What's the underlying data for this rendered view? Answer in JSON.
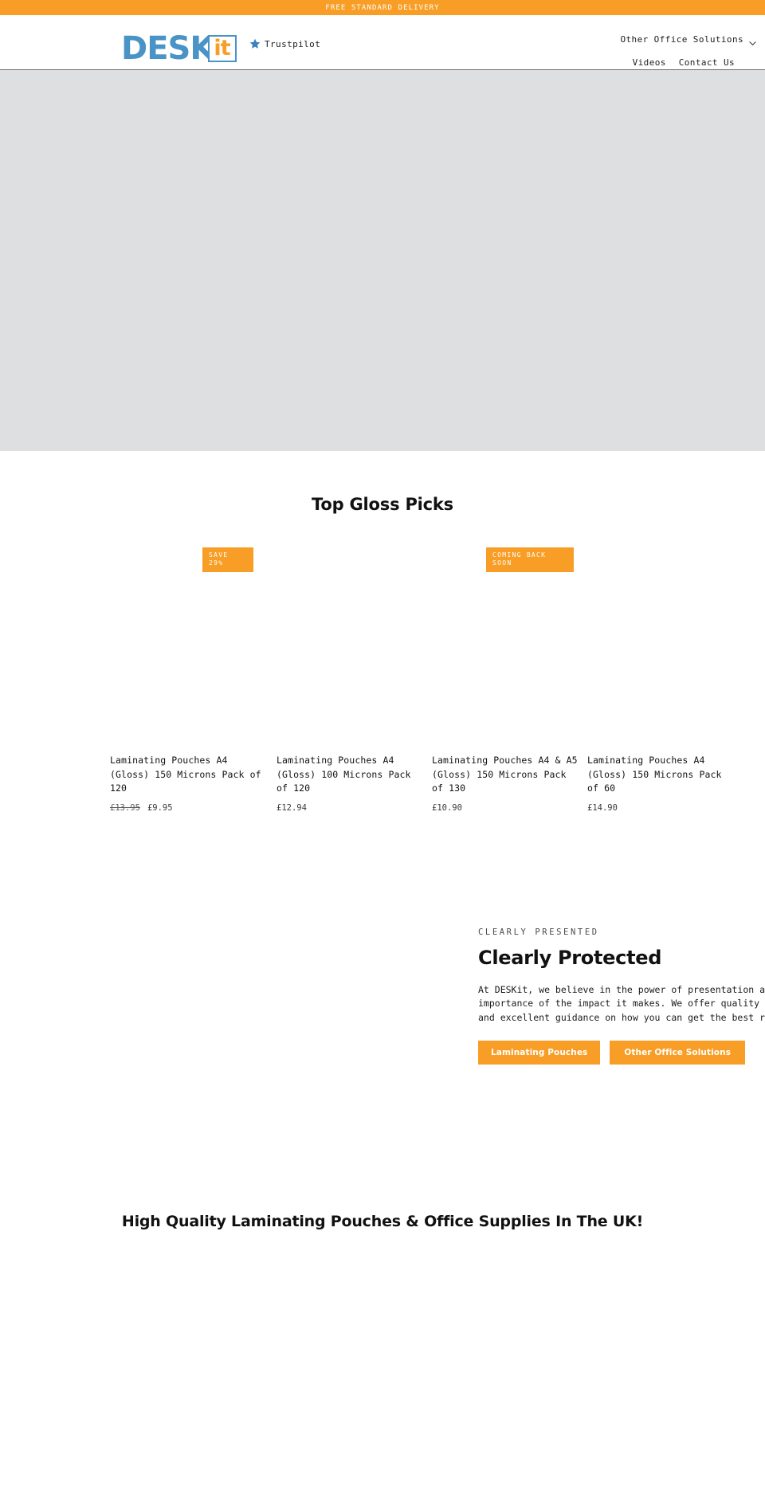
{
  "announcement": {
    "text": "FREE STANDARD DELIVERY",
    "bg_color": "#F89E26",
    "text_color": "#FFFFFF"
  },
  "header": {
    "logo": {
      "primary_text": "DESK",
      "secondary_text": "it",
      "primary_color": "#4A93C6",
      "secondary_color": "#F89E26"
    },
    "trustpilot_label": "Trustpilot",
    "nav": {
      "dropdown_label": "Other Office Solutions",
      "links": [
        "Videos",
        "Contact Us"
      ]
    }
  },
  "hero": {
    "background_color": "#DEDFE0"
  },
  "picks": {
    "title": "Top Gloss Picks",
    "products": [
      {
        "badge": "SAVE\n29%",
        "title": "Laminating Pouches A4 (Gloss) 150 Microns Pack of 120",
        "price_old": "£13.95",
        "price": "£9.95"
      },
      {
        "badge": "",
        "title": "Laminating Pouches A4 (Gloss) 100 Microns Pack of 120",
        "price_old": "",
        "price": "£12.94"
      },
      {
        "badge": "COMING BACK\nSOON",
        "title": "Laminating Pouches A4 & A5 (Gloss) 150 Microns Pack of 130",
        "price_old": "",
        "price": "£10.90"
      },
      {
        "badge": "",
        "title": "Laminating Pouches A4 (Gloss) 150 Microns Pack of 60",
        "price_old": "",
        "price": "£14.90"
      }
    ]
  },
  "feature": {
    "eyebrow": "CLEARLY PRESENTED",
    "heading": "Clearly Protected",
    "body": "At DESKit, we believe in the power of presentation and the\nimportance of the impact it makes. We offer quality products\nand excellent guidance on how you can get the best results.",
    "buttons": [
      {
        "label": "Laminating Pouches"
      },
      {
        "label": "Other Office Solutions"
      }
    ],
    "accent_color": "#F89E26"
  },
  "bottom": {
    "heading": "High Quality Laminating Pouches & Office Supplies In The UK!"
  }
}
